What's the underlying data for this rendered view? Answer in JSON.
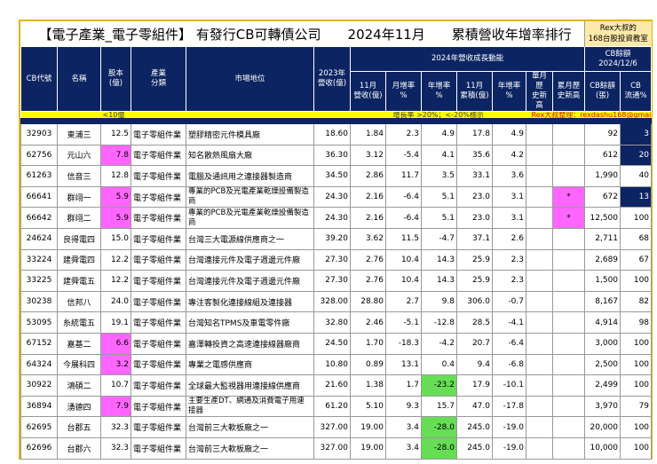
{
  "title": "【電子產業_電子零組件】 有發行CB可轉債公司　　2024年11月　　累積營收年增率排行",
  "rex_box": [
    "Rex大叔的",
    "168台股投資教室"
  ],
  "headers": {
    "code": "CB代號",
    "name": "名稱",
    "capital": "股本\n(億)",
    "industry": "產業\n分類",
    "position": "市場地位",
    "rev2023": "2023年\n營收(億)",
    "group2024": "2024年營收成長動能",
    "cbgroup": "CB餘額\n2024/12/6",
    "nov_rev": "11月\n營收(億)",
    "mom": "月增率\n%",
    "yoy": "年增率\n%",
    "nov_cum": "11月\n累積(億)",
    "cum_yoy": "年增率\n%",
    "single_high": "單月歷\n史新高",
    "cum_high": "累月歷\n史新高",
    "cb_bal": "CB餘額\n(張)",
    "cb_float": "CB\n流通%"
  },
  "legend": {
    "small_cap": "<10億",
    "growth": "增長率 >20%；<-20%標示",
    "author": "Rex大叔整理：rexdashu168@gmail.com"
  },
  "colors": {
    "navy": "#0c2461",
    "magenta": "#ff66ff",
    "green": "#66dd55",
    "gold": "#e2b400",
    "yellow": "#ffff00"
  },
  "rows": [
    [
      "32903",
      "東浦三",
      "12.5",
      "電子零組件業",
      "塑膠精密元件模具廠",
      "18.60",
      "1.84",
      "2.3",
      "4.9",
      "17.8",
      "4.9",
      "",
      "",
      "92",
      "3"
    ],
    [
      "62756",
      "元山六",
      "7.8",
      "電子零組件業",
      "知名散熱風扇大廠",
      "36.30",
      "3.12",
      "-5.4",
      "4.1",
      "35.6",
      "4.2",
      "",
      "",
      "612",
      "20"
    ],
    [
      "61263",
      "信音三",
      "12.8",
      "電子零組件業",
      "電腦及通訊用之連接器製造商",
      "34.50",
      "2.86",
      "11.7",
      "3.5",
      "33.1",
      "3.6",
      "",
      "",
      "1,990",
      "40"
    ],
    [
      "66641",
      "群翊一",
      "5.9",
      "電子零組件業",
      "專業的PCB及光電產業乾燥設備製造商",
      "24.30",
      "2.16",
      "-6.4",
      "5.1",
      "23.0",
      "3.1",
      "",
      "*",
      "672",
      "13"
    ],
    [
      "66642",
      "群翊二",
      "5.9",
      "電子零組件業",
      "專業的PCB及光電產業乾燥設備製造商",
      "24.30",
      "2.16",
      "-6.4",
      "5.1",
      "23.0",
      "3.1",
      "",
      "*",
      "12,500",
      "100"
    ],
    [
      "24624",
      "良得電四",
      "15.0",
      "電子零組件業",
      "台灣三大電源線供應商之一",
      "39.20",
      "3.62",
      "11.5",
      "-4.7",
      "37.1",
      "2.6",
      "",
      "",
      "2,711",
      "68"
    ],
    [
      "33224",
      "建舜電四",
      "12.2",
      "電子零組件業",
      "台灣連接元件及電子週邊元件廠",
      "27.30",
      "2.76",
      "10.4",
      "14.3",
      "25.9",
      "2.3",
      "",
      "",
      "2,689",
      "67"
    ],
    [
      "33225",
      "建舜電五",
      "12.2",
      "電子零組件業",
      "台灣連接元件及電子週邊元件廠",
      "27.30",
      "2.76",
      "10.4",
      "14.3",
      "25.9",
      "2.3",
      "",
      "",
      "1,500",
      "100"
    ],
    [
      "30238",
      "信邦八",
      "24.0",
      "電子零組件業",
      "專注客製化連接線組及連接器",
      "328.00",
      "28.80",
      "2.7",
      "9.8",
      "306.0",
      "-0.7",
      "",
      "",
      "8,167",
      "82"
    ],
    [
      "53095",
      "糸統電五",
      "19.1",
      "電子零組件業",
      "台灣知名TPMS及車電零件廠",
      "32.80",
      "2.46",
      "-5.1",
      "-12.8",
      "28.5",
      "-4.1",
      "",
      "",
      "4,914",
      "98"
    ],
    [
      "67152",
      "嘉基二",
      "6.6",
      "電子零組件業",
      "嘉澤轉投資之高速連接線器廠商",
      "24.50",
      "1.70",
      "-18.3",
      "-4.2",
      "20.7",
      "-6.4",
      "",
      "",
      "3,000",
      "100"
    ],
    [
      "64324",
      "今展科四",
      "3.2",
      "電子零組件業",
      "專業之電感供應商",
      "10.80",
      "0.89",
      "13.1",
      "0.4",
      "9.4",
      "-6.8",
      "",
      "",
      "2,500",
      "100"
    ],
    [
      "30922",
      "鴻碩二",
      "10.7",
      "電子零組件業",
      "全球最大監視器用連接線供應商",
      "21.60",
      "1.38",
      "1.7",
      "-23.2",
      "17.9",
      "-10.1",
      "",
      "",
      "2,499",
      "100"
    ],
    [
      "36894",
      "湧德四",
      "7.9",
      "電子零組件業",
      "主要生產DT、網通及消費電子用連接器",
      "61.20",
      "5.10",
      "9.3",
      "15.7",
      "47.0",
      "-17.8",
      "",
      "",
      "3,970",
      "79"
    ],
    [
      "62695",
      "台郡五",
      "32.3",
      "電子零組件業",
      "台灣前三大軟板廠之一",
      "327.00",
      "19.00",
      "3.4",
      "-28.0",
      "245.0",
      "-19.0",
      "",
      "",
      "20,000",
      "100"
    ],
    [
      "62696",
      "台郡六",
      "32.3",
      "電子零組件業",
      "台灣前三大軟板廠之一",
      "327.00",
      "19.00",
      "3.4",
      "-28.0",
      "245.0",
      "-19.0",
      "",
      "",
      "10,000",
      "100"
    ]
  ]
}
